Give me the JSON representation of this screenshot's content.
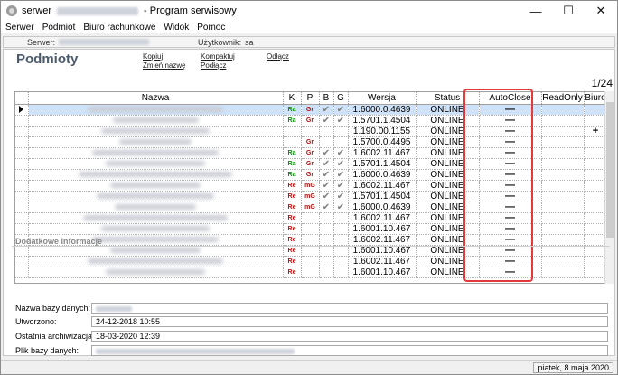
{
  "window": {
    "title_prefix": "serwer",
    "title_suffix": "- Program serwisowy",
    "minimize": "—",
    "maximize": "☐",
    "close": "✕"
  },
  "menu": [
    "Serwer",
    "Podmiot",
    "Biuro rachunkowe",
    "Widok",
    "Pomoc"
  ],
  "serverbar": {
    "server_label": "Serwer:",
    "user_label": "Użytkownik:",
    "user_value": "sa"
  },
  "page_title": "Podmioty",
  "actions": {
    "kopiuj": "Kopiuj",
    "zmien_nazwe": "Zmień nazwę",
    "kompaktuj": "Kompaktuj",
    "podlacz": "Podłącz",
    "odlacz": "Odłącz"
  },
  "pager": "1/24",
  "columns": {
    "nazwa": "Nazwa",
    "k": "K",
    "p": "P",
    "b": "B",
    "g": "G",
    "wersja": "Wersja",
    "status": "Status",
    "autoclose": "AutoClose",
    "readonly": "ReadOnly",
    "biuro": "Biuro"
  },
  "rows": [
    {
      "k": "Ra",
      "kc": "green",
      "p": "Gr",
      "b": "✔",
      "g": "✔",
      "wersja": "1.6000.0.4639",
      "status": "ONLINE",
      "autoclose": "—",
      "readonly": "",
      "biuro": ""
    },
    {
      "k": "Ra",
      "kc": "green",
      "p": "Gr",
      "b": "✔",
      "g": "✔",
      "wersja": "1.5701.1.4504",
      "status": "ONLINE",
      "autoclose": "—",
      "readonly": "",
      "biuro": ""
    },
    {
      "k": "",
      "kc": "green",
      "p": "",
      "b": "",
      "g": "",
      "wersja": "1.190.00.1155",
      "status": "ONLINE",
      "autoclose": "—",
      "readonly": "",
      "biuro": "+"
    },
    {
      "k": "",
      "kc": "green",
      "p": "Gr",
      "b": "",
      "g": "",
      "wersja": "1.5700.0.4495",
      "status": "ONLINE",
      "autoclose": "—",
      "readonly": "",
      "biuro": ""
    },
    {
      "k": "Ra",
      "kc": "green",
      "p": "Gr",
      "b": "✔",
      "g": "✔",
      "wersja": "1.6002.11.467",
      "status": "ONLINE",
      "autoclose": "—",
      "readonly": "",
      "biuro": ""
    },
    {
      "k": "Ra",
      "kc": "green",
      "p": "Gr",
      "b": "✔",
      "g": "✔",
      "wersja": "1.5701.1.4504",
      "status": "ONLINE",
      "autoclose": "—",
      "readonly": "",
      "biuro": ""
    },
    {
      "k": "Ra",
      "kc": "green",
      "p": "Gr",
      "b": "✔",
      "g": "✔",
      "wersja": "1.6000.0.4639",
      "status": "ONLINE",
      "autoclose": "—",
      "readonly": "",
      "biuro": ""
    },
    {
      "k": "Re",
      "kc": "red",
      "p": "mG",
      "b": "✔",
      "g": "✔",
      "wersja": "1.6002.11.467",
      "status": "ONLINE",
      "autoclose": "—",
      "readonly": "",
      "biuro": ""
    },
    {
      "k": "Re",
      "kc": "red",
      "p": "mG",
      "b": "✔",
      "g": "✔",
      "wersja": "1.5701.1.4504",
      "status": "ONLINE",
      "autoclose": "—",
      "readonly": "",
      "biuro": ""
    },
    {
      "k": "Re",
      "kc": "red",
      "p": "mG",
      "b": "✔",
      "g": "✔",
      "wersja": "1.6000.0.4639",
      "status": "ONLINE",
      "autoclose": "—",
      "readonly": "",
      "biuro": ""
    },
    {
      "k": "Re",
      "kc": "red",
      "p": "",
      "b": "",
      "g": "",
      "wersja": "1.6002.11.467",
      "status": "ONLINE",
      "autoclose": "—",
      "readonly": "",
      "biuro": ""
    },
    {
      "k": "Re",
      "kc": "red",
      "p": "",
      "b": "",
      "g": "",
      "wersja": "1.6001.10.467",
      "status": "ONLINE",
      "autoclose": "—",
      "readonly": "",
      "biuro": ""
    },
    {
      "k": "Re",
      "kc": "red",
      "p": "",
      "b": "",
      "g": "",
      "wersja": "1.6002.11.467",
      "status": "ONLINE",
      "autoclose": "—",
      "readonly": "",
      "biuro": ""
    },
    {
      "k": "Re",
      "kc": "red",
      "p": "",
      "b": "",
      "g": "",
      "wersja": "1.6001.10.467",
      "status": "ONLINE",
      "autoclose": "—",
      "readonly": "",
      "biuro": ""
    },
    {
      "k": "Re",
      "kc": "red",
      "p": "",
      "b": "",
      "g": "",
      "wersja": "1.6002.11.467",
      "status": "ONLINE",
      "autoclose": "—",
      "readonly": "",
      "biuro": ""
    },
    {
      "k": "Re",
      "kc": "red",
      "p": "",
      "b": "",
      "g": "",
      "wersja": "1.6001.10.467",
      "status": "ONLINE",
      "autoclose": "—",
      "readonly": "",
      "biuro": ""
    }
  ],
  "details": {
    "title": "Dodatkowe informacje",
    "nazwa_bazy_label": "Nazwa bazy danych:",
    "utworzono_label": "Utworzono:",
    "utworzono_value": "24-12-2018 10:55",
    "archiwizacja_label": "Ostatnia archiwizacja:",
    "archiwizacja_value": "18-03-2020 12:39",
    "plik_label": "Plik bazy danych:"
  },
  "status_date": "piątek, 8 maja 2020",
  "colors": {
    "highlight": "#e63a3a",
    "selected_row": "#cfe2f8",
    "k_green": "#138a13",
    "k_red": "#c21212"
  }
}
